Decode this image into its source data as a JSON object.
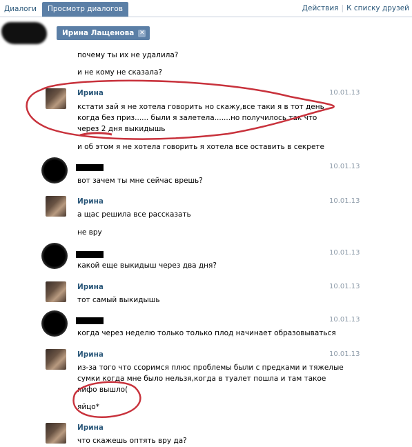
{
  "tabs": {
    "dialogs": "Диалоги",
    "view_dialogs": "Просмотр диалогов"
  },
  "top_actions": {
    "actions": "Действия",
    "back_to_friends": "К списку друзей",
    "separator": "|"
  },
  "chip": {
    "name": "Ирина Лащенова",
    "close": "✕"
  },
  "messages": [
    {
      "id": "m1",
      "text": "почему ты их не удалила?"
    },
    {
      "id": "m2",
      "text": "и не кому не сказала?"
    },
    {
      "id": "m3",
      "author": "Ирина",
      "date": "10.01.13",
      "lines": [
        "кстати зай я не хотела говорить но скажу,все таки я в тот день",
        "когда без приз...... были я залетела.......но получилось так что",
        "через 2 дня выкидышь"
      ]
    },
    {
      "id": "m4",
      "text": "и об этом я не хотела говорить я хотела все оставить в секрете"
    },
    {
      "id": "m5",
      "date": "10.01.13",
      "text": "вот зачем ты мне сейчас врешь?"
    },
    {
      "id": "m6",
      "author": "Ирина",
      "date": "10.01.13",
      "text": "а щас решила все рассказать"
    },
    {
      "id": "m7",
      "text": "не вру"
    },
    {
      "id": "m8",
      "date": "10.01.13",
      "text": "какой еще выкидыш через два дня?"
    },
    {
      "id": "m9",
      "author": "Ирина",
      "date": "10.01.13",
      "text": "тот самый выкидышь"
    },
    {
      "id": "m10",
      "date": "10.01.13",
      "text": "когда через неделю только только плод начинает образовываться"
    },
    {
      "id": "m11",
      "author": "Ирина",
      "date": "10.01.13",
      "lines": [
        "из-за того что ссоримся плюс проблемы были с предками и тяжелые",
        "сумки когда мне было нельзя,когда в туалет пошла и там такое",
        "яйфо вышло("
      ]
    },
    {
      "id": "m12",
      "text": "яйцо*"
    },
    {
      "id": "m13",
      "author": "Ирина",
      "text": "что скажешь оптять вру да?"
    }
  ],
  "colors": {
    "link": "#2b587a",
    "tab_active": "#5b7fa6",
    "date": "#8c9aa8",
    "annotation": "#c8323c"
  }
}
